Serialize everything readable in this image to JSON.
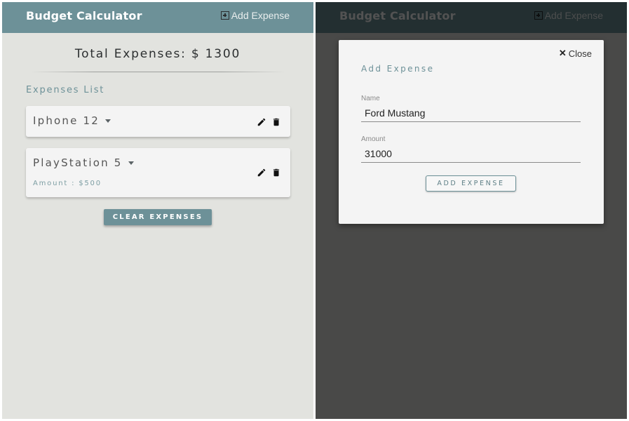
{
  "app": {
    "title": "Budget Calculator",
    "add_expense_link": "Add Expense"
  },
  "summary": {
    "total_label": "Total Expenses: $ 1300"
  },
  "expenses": {
    "heading": "Expenses List",
    "items": [
      {
        "name": "Iphone 12",
        "detail": ""
      },
      {
        "name": "PlayStation 5",
        "detail": "Amount : $500"
      }
    ],
    "clear_button": "CLEAR EXPENSES"
  },
  "modal": {
    "close_label": "Close",
    "title": "Add Expense",
    "name_label": "Name",
    "name_value": "Ford Mustang",
    "amount_label": "Amount",
    "amount_value": "31000",
    "submit_label": "ADD EXPENSE"
  },
  "colors": {
    "accent": "#6d9198",
    "background": "#e2e3df",
    "card": "#f4f4f4",
    "overlay": "rgba(0,0,0,0.68)"
  },
  "icons": {
    "add": "plus-square-icon",
    "caret": "caret-down-icon",
    "edit": "pencil-icon",
    "delete": "trash-icon",
    "close": "close-icon"
  }
}
